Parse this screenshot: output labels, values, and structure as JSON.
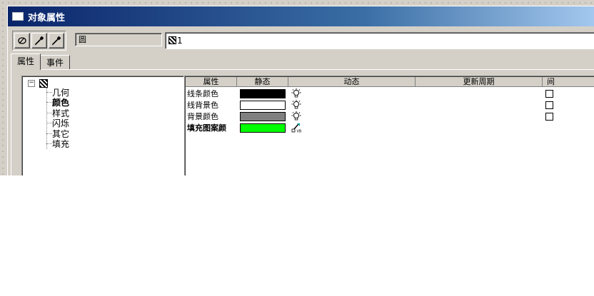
{
  "window": {
    "title": "对象属性"
  },
  "toolbar": {
    "buttons": [
      {
        "icon": "select-icon"
      },
      {
        "icon": "eyedropper-icon"
      },
      {
        "icon": "eyedropper-icon"
      }
    ],
    "object_type": "圆",
    "object_name": "1"
  },
  "tabs": [
    {
      "label": "属性",
      "active": true
    },
    {
      "label": "事件",
      "active": false
    }
  ],
  "tree": {
    "items": [
      "几何",
      "颜色",
      "样式",
      "闪烁",
      "其它",
      "填充"
    ],
    "selected": "颜色"
  },
  "grid": {
    "columns": [
      "属性",
      "静态",
      "动态",
      "更新周期",
      "间"
    ],
    "rows": [
      {
        "label": "线条颜色",
        "color": "#000000",
        "dynamic_icon": "lightbulb-icon"
      },
      {
        "label": "线背景色",
        "color": "#ffffff",
        "dynamic_icon": "lightbulb-icon"
      },
      {
        "label": "背景颜色",
        "color": "#808080",
        "dynamic_icon": "lightbulb-icon"
      },
      {
        "label": "填充图案颜",
        "color": "#00ff00",
        "dynamic_icon": "vb-script-icon"
      }
    ]
  }
}
